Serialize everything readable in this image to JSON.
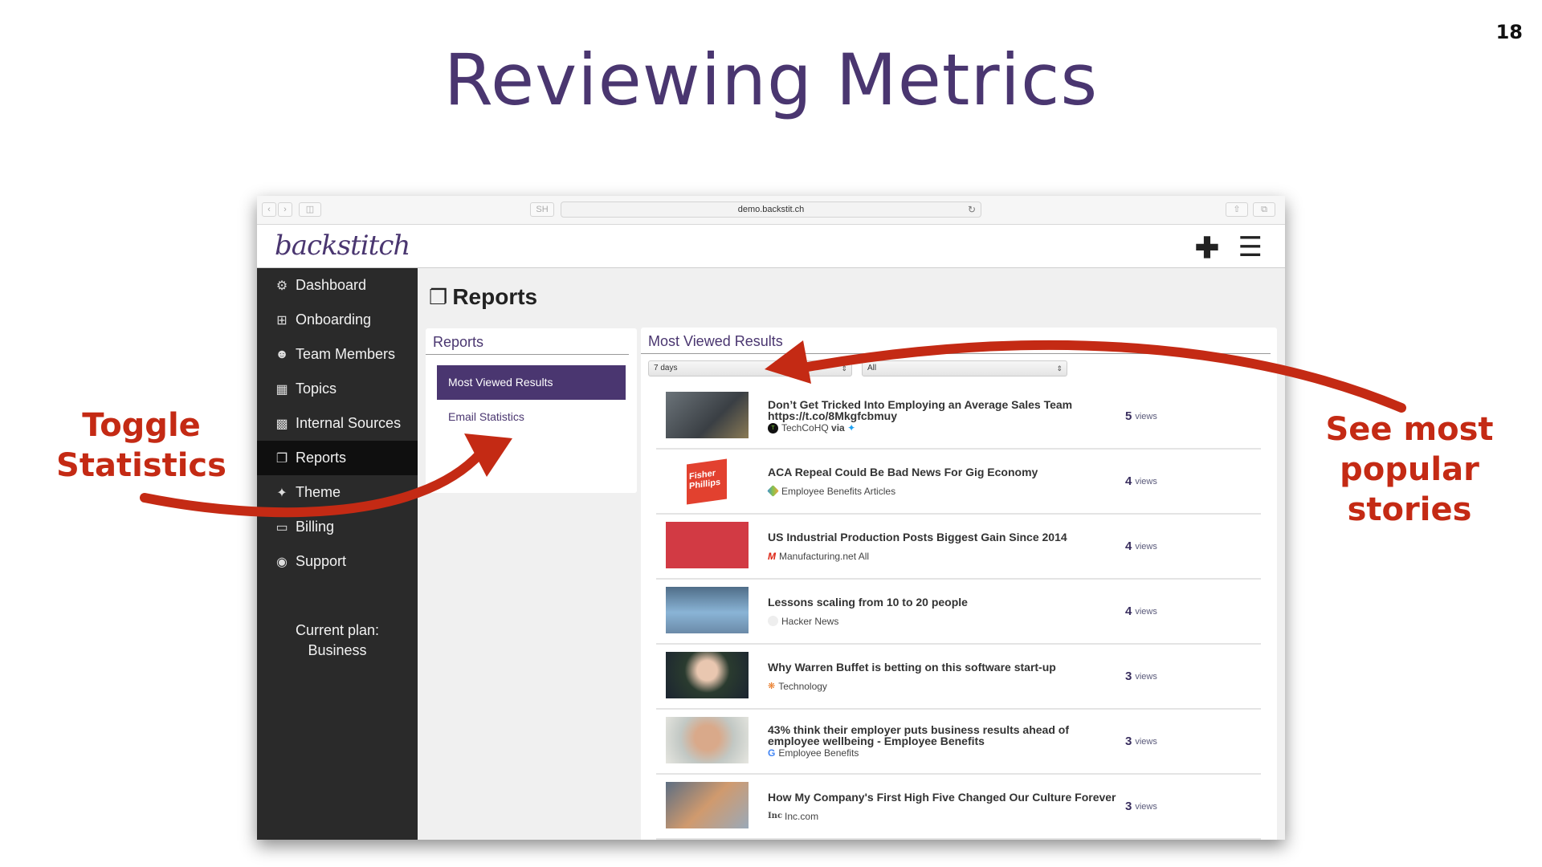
{
  "slide": {
    "title": "Reviewing Metrics",
    "page_number": "18",
    "annotations": {
      "left": "Toggle Statistics",
      "right": "See most popular stories"
    },
    "accent_color": "#4a3670",
    "annotation_color": "#c42a14"
  },
  "browser": {
    "url": "demo.backstit.ch",
    "sh_label": "SH"
  },
  "app": {
    "logo": "backstitch",
    "sidebar": {
      "items": [
        {
          "label": "Dashboard",
          "icon": "dashboard-icon"
        },
        {
          "label": "Onboarding",
          "icon": "plus-square-icon"
        },
        {
          "label": "Team Members",
          "icon": "users-icon"
        },
        {
          "label": "Topics",
          "icon": "grid-icon"
        },
        {
          "label": "Internal Sources",
          "icon": "building-icon"
        },
        {
          "label": "Reports",
          "icon": "copy-icon",
          "active": true
        },
        {
          "label": "Theme",
          "icon": "magic-wand-icon"
        },
        {
          "label": "Billing",
          "icon": "credit-card-icon"
        },
        {
          "label": "Support",
          "icon": "life-ring-icon"
        }
      ],
      "plan_label": "Current plan:",
      "plan_value": "Business"
    },
    "page_title": "Reports",
    "reports_panel": {
      "title": "Reports",
      "items": [
        "Most Viewed Results",
        "Email Statistics"
      ],
      "active": "Most Viewed Results"
    },
    "results_panel": {
      "title": "Most Viewed Results",
      "period_select": "7 days",
      "filter_select": "All",
      "results": [
        {
          "title": "Don’t Get Tricked Into Employing an Average Sales Team https://t.co/8Mkgfcbmuy",
          "source": "TechCoHQ",
          "via": "via",
          "views": "5",
          "views_label": "views"
        },
        {
          "title": "ACA Repeal Could Be Bad News For Gig Economy",
          "source": "Employee Benefits Articles",
          "views": "4",
          "views_label": "views"
        },
        {
          "title": "US Industrial Production Posts Biggest Gain Since 2014",
          "source": "Manufacturing.net All",
          "views": "4",
          "views_label": "views"
        },
        {
          "title": "Lessons scaling from 10 to 20 people",
          "source": "Hacker News",
          "views": "4",
          "views_label": "views"
        },
        {
          "title": "Why Warren Buffet is betting on this software start-up",
          "source": "Technology",
          "views": "3",
          "views_label": "views"
        },
        {
          "title": "43% think their employer puts business results ahead of employee wellbeing - Employee Benefits",
          "source": "Employee Benefits",
          "views": "3",
          "views_label": "views"
        },
        {
          "title": "How My Company's First High Five Changed Our Culture Forever",
          "source": "Inc.com",
          "views": "3",
          "views_label": "views"
        }
      ]
    }
  }
}
